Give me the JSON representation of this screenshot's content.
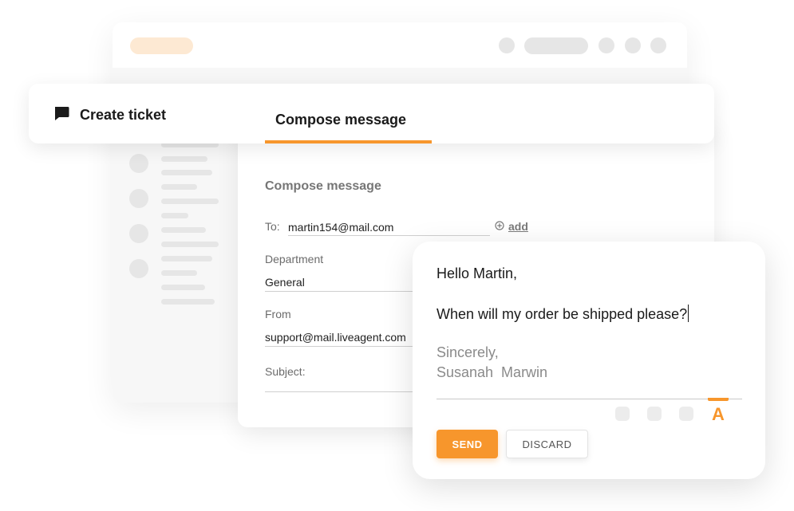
{
  "colors": {
    "accent": "#f7962c",
    "accent_light": "#fde9d3",
    "placeholder_gray": "#e6e6e6"
  },
  "header": {
    "create_ticket_icon": "chat-bubble-icon",
    "create_ticket_label": "Create ticket",
    "active_tab_label": "Compose message"
  },
  "compose": {
    "section_title": "Compose message",
    "to_label": "To:",
    "to_value": "martin154@mail.com",
    "add_icon": "plus-circle-icon",
    "add_label": "add",
    "department_label": "Department",
    "department_value": "General",
    "from_label": "From",
    "from_value": "support@mail.liveagent.com",
    "subject_label": "Subject:",
    "subject_value": ""
  },
  "message": {
    "greeting": "Hello Martin,",
    "body": "When will my order be shipped please?",
    "signoff": "Sincerely,",
    "signature": "Susanah  Marwin",
    "font_color_tool_icon": "font-color-icon",
    "font_color_letter": "A",
    "send_label": "SEND",
    "discard_label": "DISCARD"
  }
}
